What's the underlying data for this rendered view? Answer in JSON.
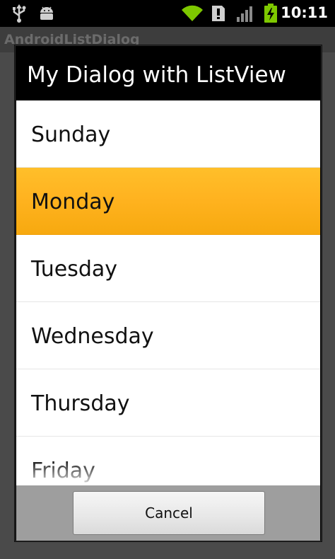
{
  "status_bar": {
    "time": "10:11",
    "icons": [
      "usb-icon",
      "android-icon",
      "wifi-icon",
      "alert-icon",
      "signal-icon",
      "battery-charging-icon"
    ]
  },
  "app": {
    "title": "AndroidListDialog"
  },
  "dialog": {
    "title": "My Dialog with ListView",
    "items": [
      {
        "label": "Sunday",
        "selected": false
      },
      {
        "label": "Monday",
        "selected": true
      },
      {
        "label": "Tuesday",
        "selected": false
      },
      {
        "label": "Wednesday",
        "selected": false
      },
      {
        "label": "Thursday",
        "selected": false
      },
      {
        "label": "Friday",
        "selected": false
      }
    ],
    "cancel_label": "Cancel"
  },
  "colors": {
    "selected": "#ffb320",
    "title_bar": "#000000",
    "button_bar": "#9e9e9e"
  }
}
